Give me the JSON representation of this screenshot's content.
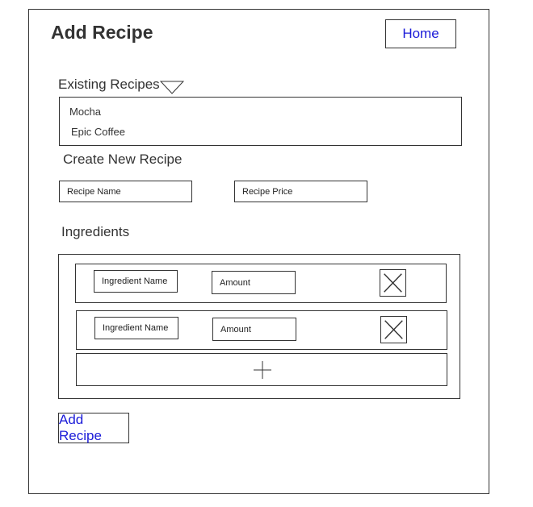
{
  "header": {
    "title": "Add Recipe",
    "home_label": "Home"
  },
  "existing": {
    "label": "Existing Recipes",
    "items": [
      "Mocha",
      "Epic Coffee"
    ]
  },
  "create": {
    "label": "Create New Recipe",
    "name_placeholder": "Recipe Name",
    "price_placeholder": "Recipe Price"
  },
  "ingredients": {
    "label": "Ingredients",
    "rows": [
      {
        "name_placeholder": "Ingredient Name",
        "amount_placeholder": "Amount"
      },
      {
        "name_placeholder": "Ingredient Name",
        "amount_placeholder": "Amount"
      }
    ]
  },
  "actions": {
    "submit_label": "Add Recipe"
  },
  "colors": {
    "link": "#1a1ad8",
    "line": "#333333"
  }
}
